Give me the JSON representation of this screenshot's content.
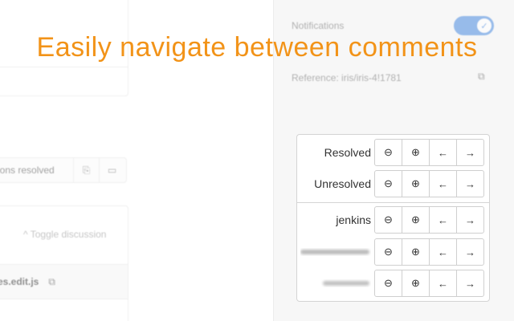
{
  "background": {
    "threads_resolved_text": "ions resolved",
    "toggle_discussion_text": "Toggle discussion",
    "file_name": "es.edit.js"
  },
  "sidebar": {
    "notifications_label": "Notifications",
    "notifications_on": true,
    "reference_text": "Reference: iris/iris-4!1781"
  },
  "headline": "Easily navigate between comments",
  "navigator": {
    "rows": [
      {
        "label": "Resolved",
        "blurred": false
      },
      {
        "label": "Unresolved",
        "blurred": false
      },
      {
        "label": "jenkins",
        "blurred": false
      },
      {
        "label": "",
        "blurred": true
      },
      {
        "label": "",
        "blurred": true
      }
    ],
    "buttons": {
      "collapse": "⊖",
      "expand": "⊕",
      "prev": "←",
      "next": "→"
    }
  },
  "colors": {
    "headline": "#f29318",
    "toggle": "#4a8be0"
  }
}
